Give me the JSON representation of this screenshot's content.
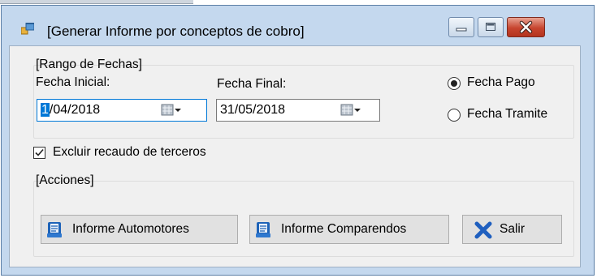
{
  "window": {
    "title": "[Generar Informe por conceptos de cobro]"
  },
  "rango": {
    "title": "[Rango de Fechas]",
    "fecha_inicial_label": "Fecha Inicial:",
    "fecha_inicial_selected": "1",
    "fecha_inicial_rest": "/04/2018",
    "fecha_final_label": "Fecha Final:",
    "fecha_final_value": "31/05/2018"
  },
  "tipo_fecha": {
    "options": [
      {
        "label": "Fecha Pago",
        "selected": true
      },
      {
        "label": "Fecha Tramite",
        "selected": false
      }
    ]
  },
  "excluir": {
    "label": "Excluir recaudo de terceros",
    "checked": true
  },
  "acciones": {
    "title": "[Acciones]",
    "informe_automotores": "Informe Automotores",
    "informe_comparendos": "Informe Comparendos",
    "salir": "Salir"
  },
  "colors": {
    "accent": "#0078d7",
    "close_button": "#c7452f",
    "report_icon": "#1e63b8",
    "exit_icon": "#1f5fbf"
  },
  "icons": {
    "app": "window-icon",
    "calendar": "calendar-dropdown-icon",
    "report": "report-icon",
    "exit": "x-icon"
  }
}
